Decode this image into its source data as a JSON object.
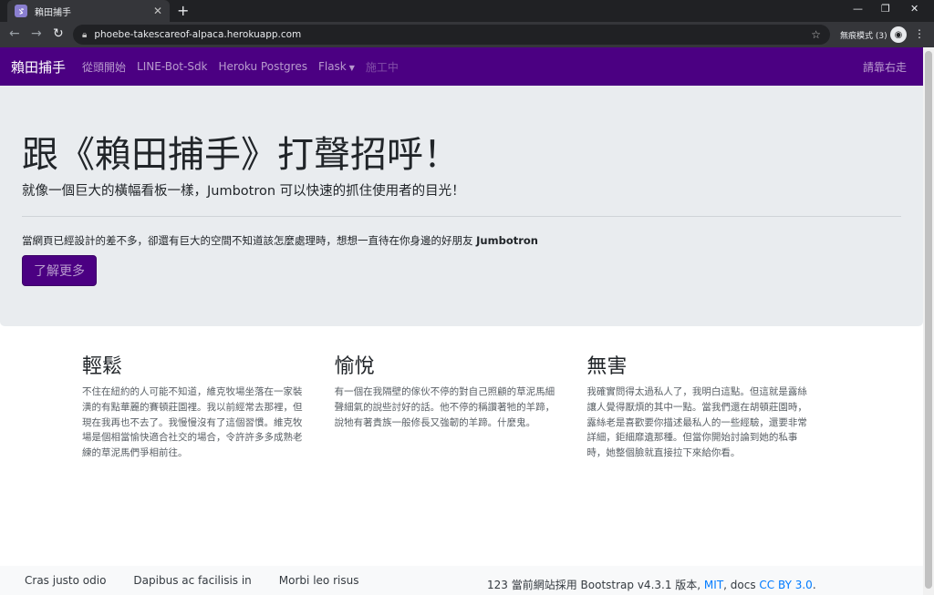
{
  "browser": {
    "tab_title": "賴田捕手",
    "tab_favicon": "alpaca-favicon",
    "new_tab": "+",
    "url": "phoebe-takescareof-alpaca.herokuapp.com",
    "incognito_label": "無痕模式 (3)"
  },
  "navbar": {
    "brand": "賴田捕手",
    "links": [
      "從頭開始",
      "LINE-Bot-Sdk",
      "Heroku Postgres",
      "Flask",
      "施工中"
    ],
    "right_link": "請靠右走"
  },
  "jumbotron": {
    "title": "跟《賴田捕手》打聲招呼！",
    "lead": "就像一個巨大的橫幅看板一樣，Jumbotron 可以快速的抓住使用者的目光！",
    "body_prefix": "當網頁已經設計的差不多，卻還有巨大的空間不知道該怎麼處理時，想想一直待在你身邊的好朋友 ",
    "body_bold": "Jumbotron",
    "button_label": "了解更多"
  },
  "columns": [
    {
      "heading": "輕鬆",
      "text": "不住在紐約的人可能不知道，維克牧場坐落在一家裝潢的有點華麗的賽頓莊園裡。我以前經常去那裡，但現在我再也不去了。我慢慢沒有了這個習慣。維克牧場是個相當愉快適合社交的場合，令許許多多成熟老練的草泥馬們爭相前往。"
    },
    {
      "heading": "愉悅",
      "text": "有一個在我隔壁的傢伙不停的對自己照顧的草泥馬細聲細氣的說些討好的話。他不停的稱讚著牠的羊蹄，說牠有著貴族一般修長又強韌的羊蹄。什麼鬼。"
    },
    {
      "heading": "無害",
      "text": "我確實問得太過私人了，我明白這點。但這就是露絲讓人覺得厭煩的其中一點。當我們還在胡頓莊園時，露絲老是喜歡要你描述最私人的一些經驗，還要非常詳細，鉅細靡遺那種。但當你開始討論到她的私事時，她整個臉就直接拉下來給你看。"
    }
  ],
  "footer": {
    "links": [
      "Cras justo odio",
      "Dapibus ac facilisis in",
      "Morbi leo risus"
    ],
    "note_prefix": "123 當前網站採用 Bootstrap v4.3.1 版本, ",
    "note_mit": "MIT",
    "note_mid": ", docs ",
    "note_cc": "CC BY 3.0",
    "note_end": "."
  },
  "colors": {
    "navbar_bg": "#4b0082",
    "jumbotron_bg": "#e9ecef",
    "link": "#007bff"
  }
}
